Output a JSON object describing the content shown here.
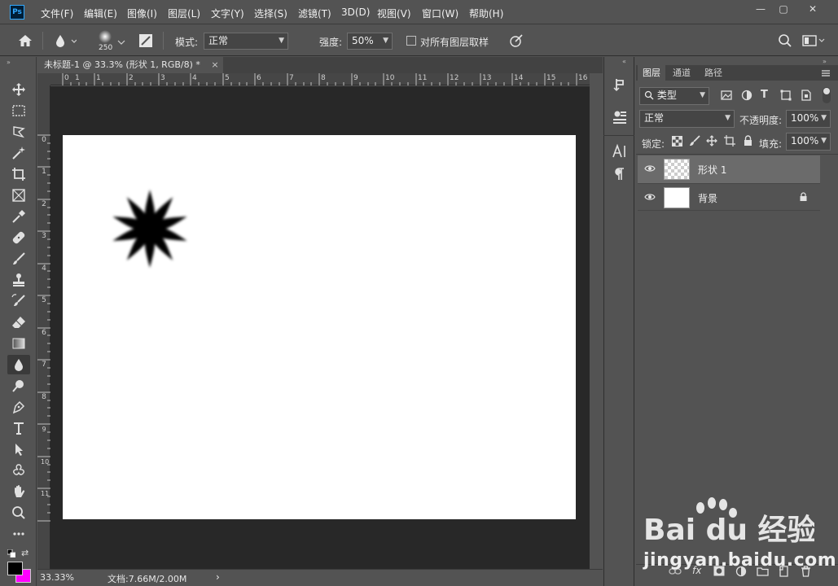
{
  "app": {
    "logo": "Ps"
  },
  "menubar": {
    "items": [
      "文件(F)",
      "编辑(E)",
      "图像(I)",
      "图层(L)",
      "文字(Y)",
      "选择(S)",
      "滤镜(T)",
      "3D(D)",
      "视图(V)",
      "窗口(W)",
      "帮助(H)"
    ],
    "window_controls": {
      "minimize": "—",
      "maximize": "▢",
      "close": "✕"
    }
  },
  "options": {
    "brush_size": "250",
    "mode_label": "模式:",
    "mode_value": "正常",
    "strength_label": "强度:",
    "strength_value": "50%",
    "sample_all_label": "对所有图层取样"
  },
  "document": {
    "tab_title": "未标题-1 @ 33.3% (形状 1, RGB/8) *",
    "tab_close": "×",
    "ruler_top": [
      "0",
      "1",
      "1",
      "2",
      "3",
      "4",
      "5",
      "6",
      "7",
      "8",
      "9",
      "10",
      "11",
      "12",
      "13",
      "14",
      "15",
      "16"
    ],
    "ruler_left": [
      "0",
      "1",
      "2",
      "3",
      "4",
      "5",
      "6",
      "7",
      "8",
      "9",
      "10",
      "11"
    ]
  },
  "status": {
    "zoom": "33.33%",
    "doc_info": "文档:7.66M/2.00M",
    "arrow": "›"
  },
  "panel": {
    "tabs": [
      "图层",
      "通道",
      "路径"
    ],
    "filter_kind": "类型",
    "blend_mode": "正常",
    "opacity_label": "不透明度:",
    "opacity_value": "100%",
    "lock_label": "锁定:",
    "fill_label": "填充:",
    "fill_value": "100%",
    "layers": [
      {
        "name": "形状 1",
        "selected": true
      },
      {
        "name": "背景",
        "selected": false
      }
    ]
  },
  "watermark": {
    "brand": "Bai du 经验",
    "url": "jingyan.baidu.com"
  },
  "colors": {
    "canvas_bg": "#282828",
    "ui_bg": "#535353",
    "foreground": "#000000",
    "background": "#ff00ff"
  }
}
